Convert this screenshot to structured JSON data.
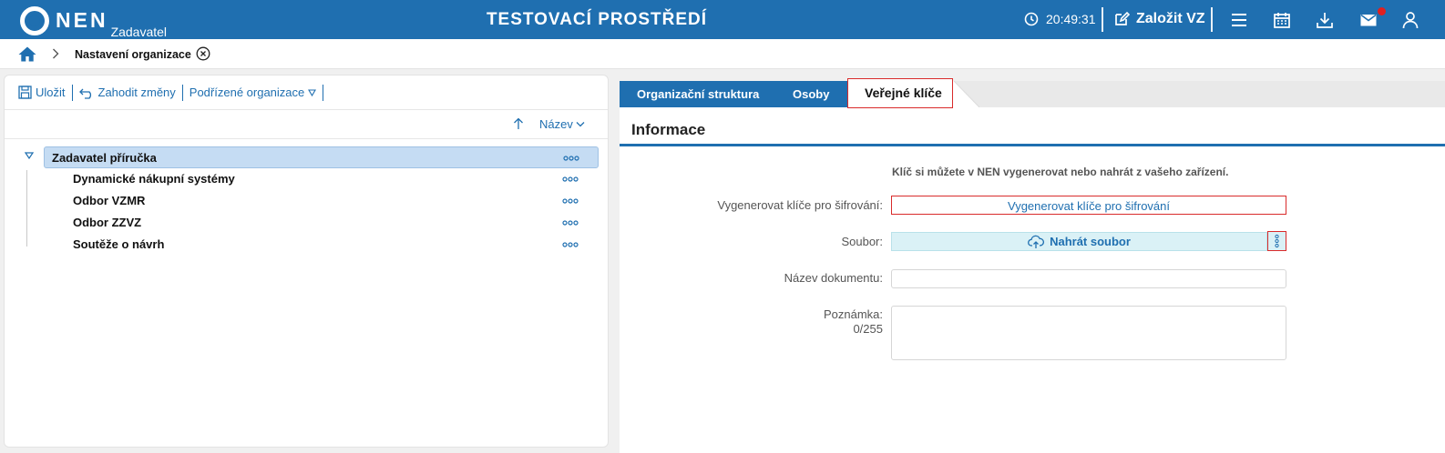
{
  "header": {
    "logo_text": "NEN",
    "logo_sub": "Zadavatel",
    "env_title": "TESTOVACÍ PROSTŘEDÍ",
    "clock": "20:49:31",
    "create_vz": "Založit VZ"
  },
  "breadcrumb": {
    "current": "Nastavení organizace"
  },
  "toolbar": {
    "save": "Uložit",
    "discard": "Zahodit změny",
    "sub_orgs": "Podřízené organizace"
  },
  "sort": {
    "name": "Název"
  },
  "tree": {
    "root": "Zadavatel příručka",
    "children": [
      "Dynamické nákupní systémy",
      "Odbor VZMR",
      "Odbor ZZVZ",
      "Soutěže o návrh"
    ]
  },
  "tabs": [
    "Organizační struktura",
    "Osoby",
    "Veřejné klíče"
  ],
  "info": {
    "title": "Informace",
    "hint": "Klíč si můžete v NEN vygenerovat nebo nahrát z vašeho zařízení.",
    "gen_label": "Vygenerovat klíče pro šifrování:",
    "gen_button": "Vygenerovat klíče pro šifrování",
    "file_label": "Soubor:",
    "upload_button": "Nahrát soubor",
    "doc_name_label": "Název dokumentu:",
    "note_label": "Poznámka:",
    "note_counter": "0/255"
  },
  "colors": {
    "primary": "#1f6fb0",
    "highlight": "#c5dcf3",
    "error_border": "#d92b2b",
    "upload_bg": "#daf1f6"
  }
}
